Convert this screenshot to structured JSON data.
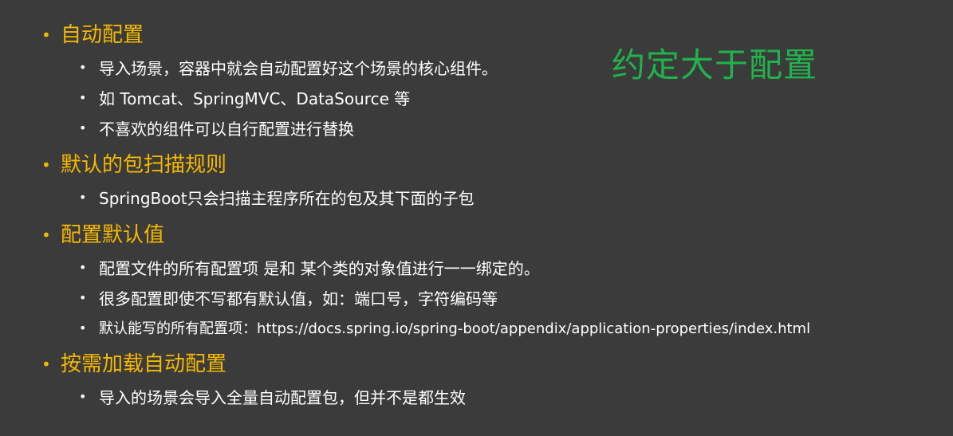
{
  "callout": "约定大于配置",
  "colors": {
    "background": "#3b3b3b",
    "heading": "#f5b800",
    "body_text": "#ffffff",
    "callout": "#21b24b"
  },
  "sections": [
    {
      "title": "自动配置",
      "items": [
        "导入场景，容器中就会自动配置好这个场景的核心组件。",
        "如 Tomcat、SpringMVC、DataSource 等",
        "不喜欢的组件可以自行配置进行替换"
      ]
    },
    {
      "title": "默认的包扫描规则",
      "items": [
        "SpringBoot只会扫描主程序所在的包及其下面的子包"
      ]
    },
    {
      "title": "配置默认值",
      "items": [
        "配置文件的所有配置项 是和 某个类的对象值进行一一绑定的。",
        "很多配置即使不写都有默认值，如：端口号，字符编码等",
        "默认能写的所有配置项：https://docs.spring.io/spring-boot/appendix/application-properties/index.html"
      ]
    },
    {
      "title": "按需加载自动配置",
      "items": [
        "导入的场景会导入全量自动配置包，但并不是都生效"
      ]
    }
  ]
}
